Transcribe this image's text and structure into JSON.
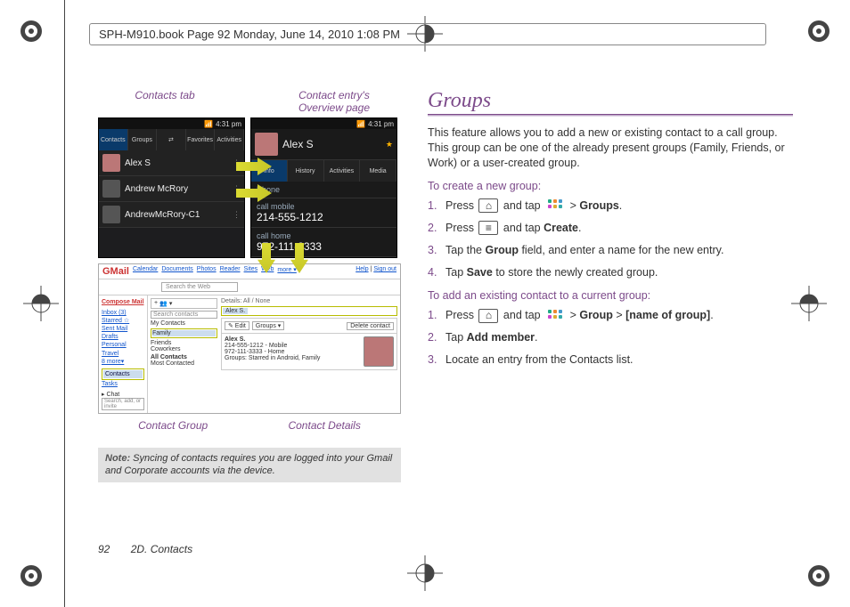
{
  "book_header": "SPH-M910.book  Page 92  Monday, June 14, 2010  1:08 PM",
  "left": {
    "label_contacts_tab": "Contacts tab",
    "label_overview": "Contact entry's\nOverview page",
    "label_contact_group": "Contact Group",
    "label_contact_details": "Contact Details",
    "phone1": {
      "time": "4:31 pm",
      "tabs": [
        "Contacts",
        "Groups",
        "⇄",
        "Favorites",
        "Activities"
      ],
      "rows": [
        "Alex S",
        "Andrew McRory",
        "AndrewMcRory-C1"
      ]
    },
    "phone2": {
      "time": "4:31 pm",
      "name_header": "Alex S",
      "tabs": [
        "Info",
        "History",
        "Activities",
        "Media"
      ],
      "section_phone": "Phone",
      "rows": [
        {
          "label": "call mobile",
          "value": "214-555-1212"
        },
        {
          "label": "call home",
          "value": "972-111-3333"
        }
      ]
    },
    "gmail": {
      "logo_text": "GMail",
      "toplinks": [
        "Calendar",
        "Documents",
        "Photos",
        "Reader",
        "Sites",
        "Web",
        "more ▾"
      ],
      "rightlinks": [
        "Help",
        "Sign out"
      ],
      "search_placeholder": "Search the Web",
      "compose": "Compose Mail",
      "side_links": [
        "Inbox (3)",
        "Starred ☆",
        "Sent Mail",
        "Drafts",
        "Personal",
        "Travel",
        "8 more▾"
      ],
      "contacts_label": "Contacts",
      "tasks_label": "Tasks",
      "chat_label": "▸ Chat",
      "chat_search": "Search, add, or invite",
      "mid": {
        "search_contacts": "Search contacts",
        "groups": [
          "My Contacts",
          "Family",
          "Friends",
          "Coworkers"
        ],
        "all_contacts": "All Contacts",
        "most_contacted": "Most Contacted",
        "detail_header": "Details: All / None",
        "selected_name": "Alex S.",
        "edit_btn": "✎ Edit",
        "groups_btn": "Groups ▾",
        "delete_btn": "Delete contact",
        "detail_name": "Alex S.",
        "detail_lines": [
          "214-555-1212 - Mobile",
          "972-111-3333 - Home",
          "Groups: Starred in Android, Family"
        ]
      }
    },
    "note_label": "Note:",
    "note_text": "Syncing of contacts requires you are logged into your Gmail and Corporate accounts via the device."
  },
  "right": {
    "heading": "Groups",
    "intro": "This feature allows you to add a new or existing contact to a call group. This group can be one of the already present groups (Family, Friends, or Work) or a user-created group.",
    "sub_create": "To create a new group:",
    "steps_create": {
      "s1_a": "Press ",
      "s1_b": " and tap ",
      "s1_c": " > ",
      "s1_d": "Groups",
      "s1_e": ".",
      "s2_a": "Press ",
      "s2_b": " and tap ",
      "s2_c": "Create",
      "s2_d": ".",
      "s3_a": "Tap the ",
      "s3_b": "Group",
      "s3_c": " field, and enter a name for the new entry.",
      "s4_a": "Tap ",
      "s4_b": "Save",
      "s4_c": " to store the newly created group."
    },
    "sub_add": "To add an existing contact to a current group:",
    "steps_add": {
      "s1_a": "Press ",
      "s1_b": " and tap ",
      "s1_c": " > ",
      "s1_d": "Group",
      "s1_e": " > ",
      "s1_f": "[name of group]",
      "s1_g": ".",
      "s2_a": "Tap ",
      "s2_b": "Add member",
      "s2_c": ".",
      "s3": "Locate an entry from the Contacts list."
    }
  },
  "footer": {
    "page_number": "92",
    "section": "2D. Contacts"
  }
}
